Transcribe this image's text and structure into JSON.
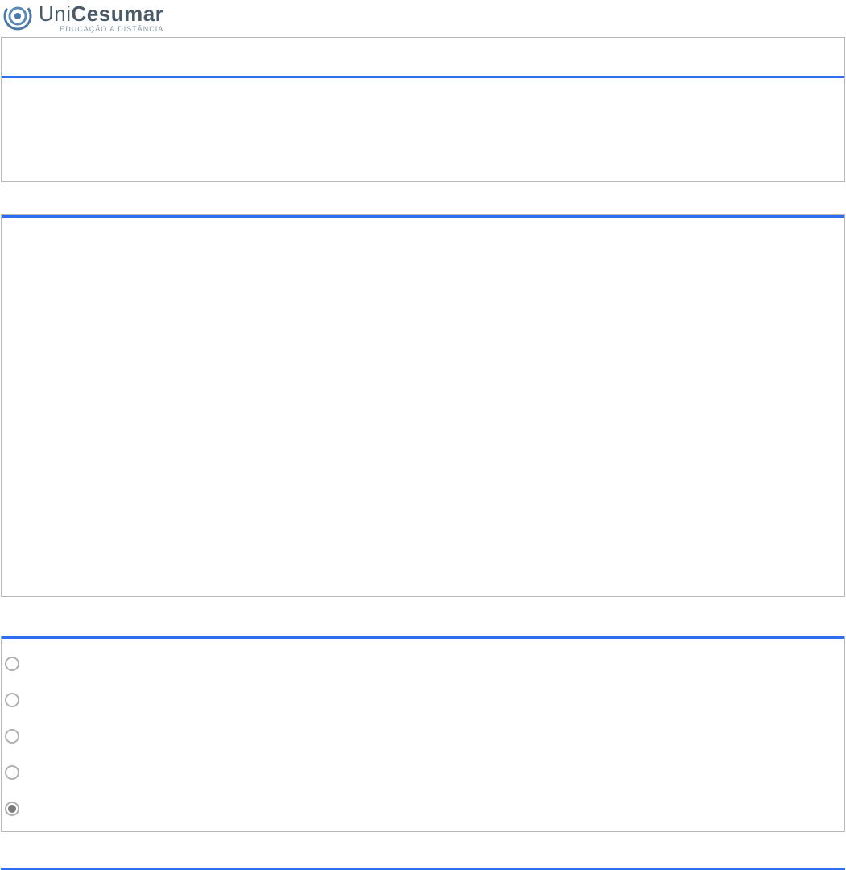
{
  "logo": {
    "brand_prefix": "Uni",
    "brand_suffix": "Cesumar",
    "subtitle": "EDUCAÇÃO A DISTÂNCIA"
  },
  "options": [
    {
      "label": "",
      "selected": false
    },
    {
      "label": "",
      "selected": false
    },
    {
      "label": "",
      "selected": false
    },
    {
      "label": "",
      "selected": false
    },
    {
      "label": "",
      "selected": true
    }
  ]
}
